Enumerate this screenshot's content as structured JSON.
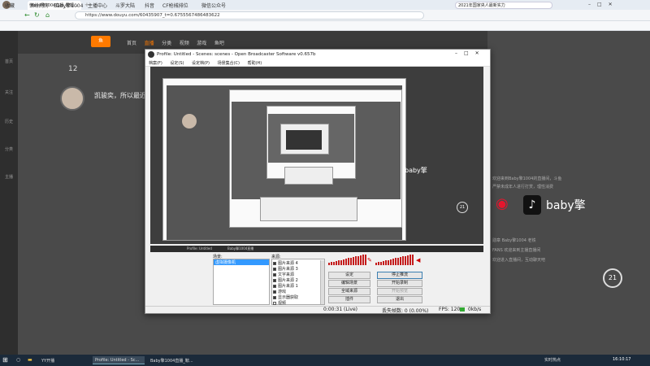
{
  "browser": {
    "tabs": [
      {
        "label": "Baby擎1004直播_鞍钢..."
      },
      {
        "label": "2021年国家央人最新实力..."
      }
    ],
    "url": "https://www.douyu.com/60435907_t=0.6755567486483622",
    "search_hint": "2021年国家央人最新实力",
    "bookmarks": [
      "收藏",
      "懒纷刑房",
      "Baby擎1004",
      "主播中心",
      "斗罗大陆",
      "抖音",
      "CF枪械排位",
      "微信公众号"
    ]
  },
  "site": {
    "nav": [
      "首页",
      "直播",
      "分类",
      "视频",
      "游戏",
      "鱼吧"
    ],
    "left_rail": [
      "首页",
      "关注",
      "历史",
      "分类",
      "主播"
    ],
    "level": "12",
    "streamer_intro": "凯骏奕，所以最近",
    "hot_count": "21",
    "chat": [
      "欢迎来到Baby擎1004的直播间，斗鱼",
      "严禁未成年人进行打赏，理性消费",
      "勋章 Baby擎1004 老铁",
      "FANS 欢迎来到主播直播间",
      "欢迎进入直播间，互动聊天吧"
    ],
    "brand": "baby擎"
  },
  "obs": {
    "title": "Profile: Untitled - Scenes: scenes - Open Broadcaster Software v0.657b",
    "menu": [
      "档案(F)",
      "设定(S)",
      "设定档(P)",
      "场景集合(C)",
      "帮助(H)"
    ],
    "scenes_label": "场景:",
    "sources_label": "来源:",
    "scenes": [
      "虚拟摄像机"
    ],
    "sources": [
      {
        "label": "图片来源 4",
        "checked": true
      },
      {
        "label": "图片来源 3",
        "checked": true
      },
      {
        "label": "文字来源",
        "checked": true
      },
      {
        "label": "图片来源 2",
        "checked": true
      },
      {
        "label": "图片来源 1",
        "checked": true
      },
      {
        "label": "游戏",
        "checked": true
      },
      {
        "label": "显示器获取",
        "checked": true
      },
      {
        "label": "视频",
        "checked": false
      }
    ],
    "buttons_left": [
      "设定",
      "编辑场景",
      "全域来源",
      "插件"
    ],
    "buttons_right": [
      {
        "label": "停止推流",
        "disabled": false
      },
      {
        "label": "开始录制",
        "disabled": false
      },
      {
        "label": "开始预览",
        "disabled": true
      },
      {
        "label": "退出",
        "disabled": false
      }
    ],
    "status": {
      "time": "0:00:31 (Live)",
      "dropped": "丢失帧数:  0 (0.00%)",
      "fps": "FPS: 120",
      "bitrate": "0kb/s"
    },
    "strip": [
      "Profile: Untitled",
      "Baby擎1004直播"
    ]
  },
  "taskbar": {
    "items": [
      {
        "label": "YY开播",
        "active": false
      },
      {
        "label": "Profile: Untitled - Sc...",
        "active": true
      },
      {
        "label": "Baby擎1004直播_鞍...",
        "active": false
      }
    ],
    "tray": "实时热点",
    "clock": "16:10:17"
  }
}
